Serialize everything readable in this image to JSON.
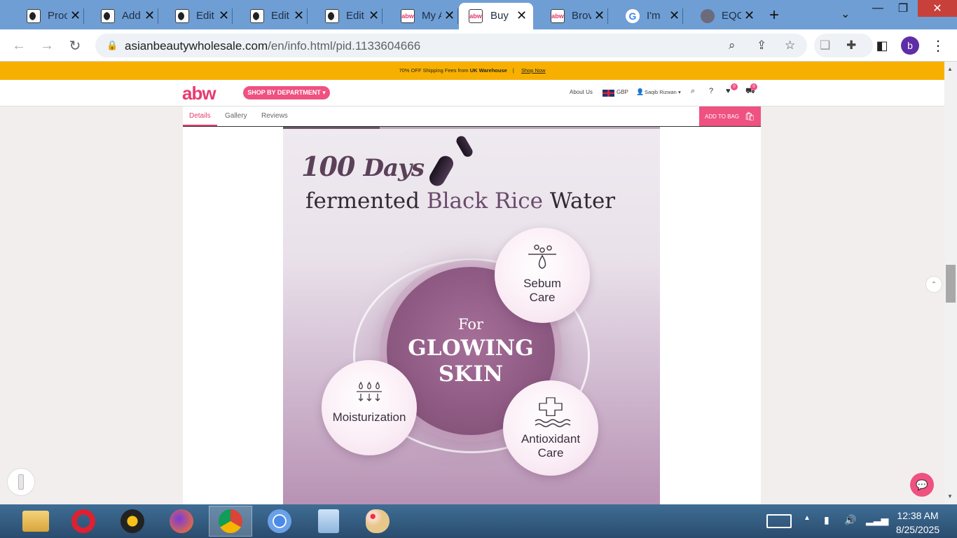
{
  "browser": {
    "tabs": [
      {
        "title": "Proc",
        "favicon": "dark-circle"
      },
      {
        "title": "Add",
        "favicon": "dark-circle"
      },
      {
        "title": "Edit",
        "favicon": "dark-circle"
      },
      {
        "title": "Edit",
        "favicon": "dark-circle"
      },
      {
        "title": "Edit",
        "favicon": "dark-circle"
      },
      {
        "title": "My A",
        "favicon": "abw"
      },
      {
        "title": "Buy",
        "favicon": "abw",
        "active": true
      },
      {
        "title": "Brov",
        "favicon": "abw"
      },
      {
        "title": "I'm",
        "favicon": "google"
      },
      {
        "title": "EQC",
        "favicon": "globe"
      }
    ],
    "favicon_abw_text": "abw",
    "favicon_google_text": "G",
    "new_tab_symbol": "+",
    "url_host": "asianbeautywholesale.com",
    "url_path": "/en/info.html/pid.1133604666",
    "profile_initial": "b"
  },
  "site": {
    "promo_text_prefix": "70% OFF Shipping Fees from ",
    "promo_text_bold": "UK Warehouse",
    "promo_separator": "|",
    "promo_link": "Shop Now",
    "logo": "abw",
    "shop_button": "SHOP BY DEPARTMENT ▾",
    "about_us": "About Us",
    "currency": "GBP",
    "user_name": "Saqib Rizwan ▾",
    "wishlist_count": "0",
    "cart_count": "0",
    "subnav": {
      "details": "Details",
      "gallery": "Gallery",
      "reviews": "Reviews",
      "add_to_bag": "ADD TO BAG"
    }
  },
  "product_image": {
    "days_number": "100",
    "days_word": "Days",
    "headline_part1": "fermented ",
    "headline_accent": "Black Rice",
    "headline_part2": " Water",
    "center_for": "For",
    "center_main": "GLOWING SKIN",
    "benefits": [
      {
        "label": "Sebum Care",
        "icon": "sebum-drop-icon"
      },
      {
        "label": "Moisturization",
        "icon": "water-drops-icon"
      },
      {
        "label": "Antioxidant Care",
        "icon": "cross-waves-icon"
      }
    ]
  },
  "system": {
    "time": "12:38 AM",
    "date": "8/25/2025"
  },
  "colors": {
    "accent": "#ef5181",
    "promo_bar": "#f8b000",
    "tab_strip": "#6e9ed4"
  }
}
